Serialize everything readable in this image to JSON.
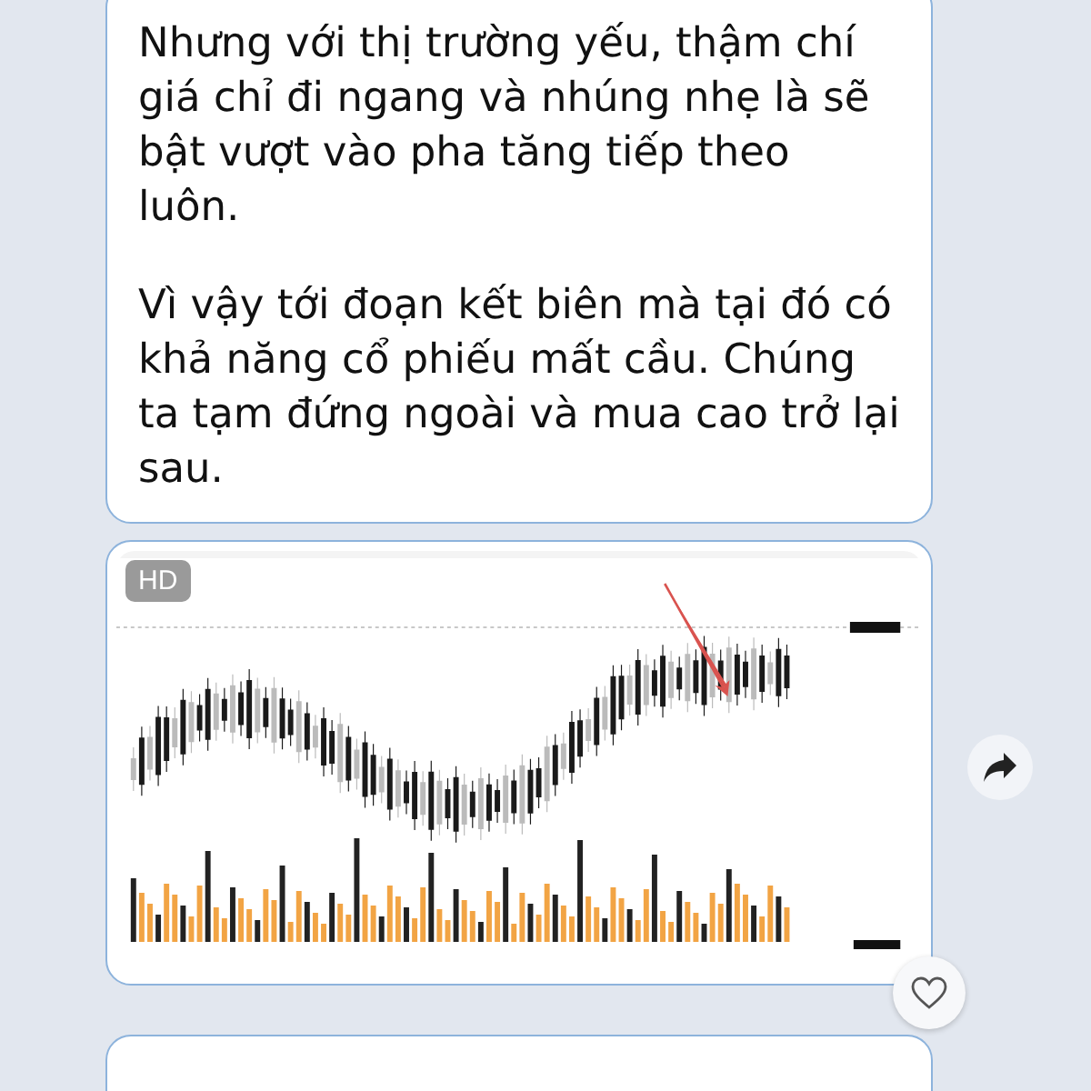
{
  "messages": [
    {
      "kind": "text",
      "paragraphs": [
        "Nhưng với thị trường yếu, thậm chí giá chỉ đi ngang và nhúng nhẹ là sẽ bật vượt vào pha tăng tiếp theo luôn.",
        "Vì vậy tới đoạn kết biên mà tại đó có khả năng cổ phiếu mất cầu. Chúng ta tạm đứng ngoài và mua cao trở lại sau."
      ]
    },
    {
      "badge": "HD",
      "liked": false
    },
    {
      "kind": "text"
    }
  ]
}
